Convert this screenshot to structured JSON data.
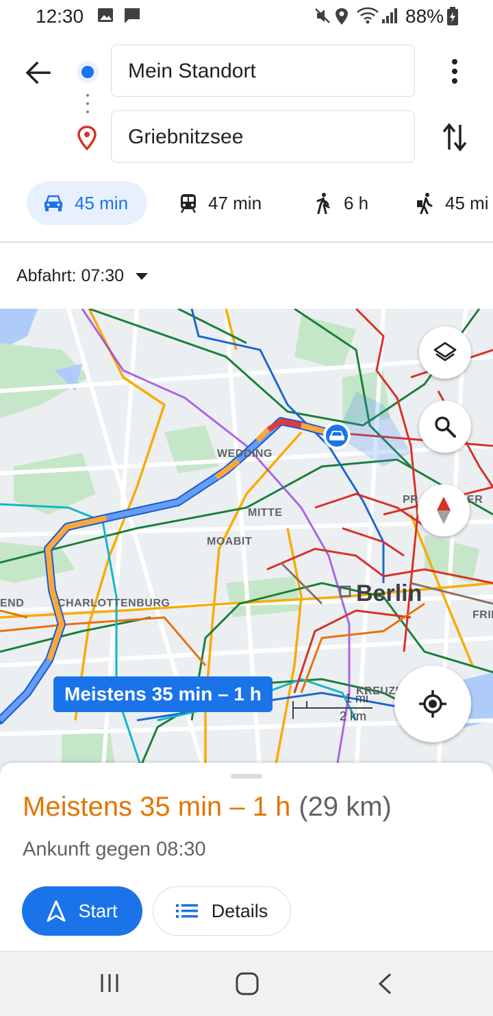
{
  "status_bar": {
    "time": "12:30",
    "battery": "88%"
  },
  "route": {
    "origin": "Mein Standort",
    "destination": "Griebnitzsee"
  },
  "modes": [
    {
      "icon": "car-icon",
      "label": "45 min",
      "selected": true
    },
    {
      "icon": "train-icon",
      "label": "47 min",
      "selected": false
    },
    {
      "icon": "walk-icon",
      "label": "6 h",
      "selected": false
    },
    {
      "icon": "ride-icon",
      "label": "45 mi",
      "selected": false
    }
  ],
  "departure": "Abfahrt: 07:30",
  "map": {
    "labels": {
      "wedding": "WEDDING",
      "mitte": "MITTE",
      "moabit": "MOABIT",
      "charlottenburg": "CHARLOTTENBURG",
      "berlin": "Berlin",
      "kreuzberg": "KREUZB",
      "end": "END",
      "frie": "FRIE",
      "pr": "PR",
      "er": "ER"
    },
    "route_callout": "Meistens 35 min – 1 h",
    "scale_mi": "1 mi",
    "scale_km": "2 km"
  },
  "sheet": {
    "duration": "Meistens 35 min – 1 h",
    "distance": "(29 km)",
    "arrival": "Ankunft gegen 08:30",
    "start_label": "Start",
    "details_label": "Details"
  },
  "colors": {
    "accent": "#1a73e8",
    "traffic_orange": "#e37400"
  }
}
